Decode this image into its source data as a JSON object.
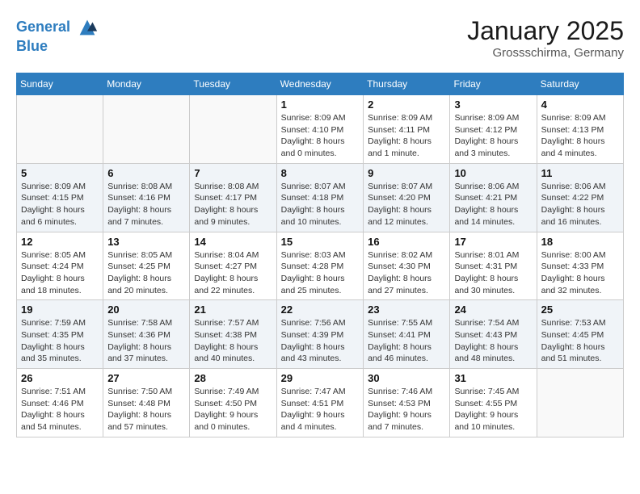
{
  "header": {
    "logo_line1": "General",
    "logo_line2": "Blue",
    "month": "January 2025",
    "location": "Grossschirma, Germany"
  },
  "weekdays": [
    "Sunday",
    "Monday",
    "Tuesday",
    "Wednesday",
    "Thursday",
    "Friday",
    "Saturday"
  ],
  "weeks": [
    [
      {
        "day": "",
        "info": ""
      },
      {
        "day": "",
        "info": ""
      },
      {
        "day": "",
        "info": ""
      },
      {
        "day": "1",
        "info": "Sunrise: 8:09 AM\nSunset: 4:10 PM\nDaylight: 8 hours\nand 0 minutes."
      },
      {
        "day": "2",
        "info": "Sunrise: 8:09 AM\nSunset: 4:11 PM\nDaylight: 8 hours\nand 1 minute."
      },
      {
        "day": "3",
        "info": "Sunrise: 8:09 AM\nSunset: 4:12 PM\nDaylight: 8 hours\nand 3 minutes."
      },
      {
        "day": "4",
        "info": "Sunrise: 8:09 AM\nSunset: 4:13 PM\nDaylight: 8 hours\nand 4 minutes."
      }
    ],
    [
      {
        "day": "5",
        "info": "Sunrise: 8:09 AM\nSunset: 4:15 PM\nDaylight: 8 hours\nand 6 minutes."
      },
      {
        "day": "6",
        "info": "Sunrise: 8:08 AM\nSunset: 4:16 PM\nDaylight: 8 hours\nand 7 minutes."
      },
      {
        "day": "7",
        "info": "Sunrise: 8:08 AM\nSunset: 4:17 PM\nDaylight: 8 hours\nand 9 minutes."
      },
      {
        "day": "8",
        "info": "Sunrise: 8:07 AM\nSunset: 4:18 PM\nDaylight: 8 hours\nand 10 minutes."
      },
      {
        "day": "9",
        "info": "Sunrise: 8:07 AM\nSunset: 4:20 PM\nDaylight: 8 hours\nand 12 minutes."
      },
      {
        "day": "10",
        "info": "Sunrise: 8:06 AM\nSunset: 4:21 PM\nDaylight: 8 hours\nand 14 minutes."
      },
      {
        "day": "11",
        "info": "Sunrise: 8:06 AM\nSunset: 4:22 PM\nDaylight: 8 hours\nand 16 minutes."
      }
    ],
    [
      {
        "day": "12",
        "info": "Sunrise: 8:05 AM\nSunset: 4:24 PM\nDaylight: 8 hours\nand 18 minutes."
      },
      {
        "day": "13",
        "info": "Sunrise: 8:05 AM\nSunset: 4:25 PM\nDaylight: 8 hours\nand 20 minutes."
      },
      {
        "day": "14",
        "info": "Sunrise: 8:04 AM\nSunset: 4:27 PM\nDaylight: 8 hours\nand 22 minutes."
      },
      {
        "day": "15",
        "info": "Sunrise: 8:03 AM\nSunset: 4:28 PM\nDaylight: 8 hours\nand 25 minutes."
      },
      {
        "day": "16",
        "info": "Sunrise: 8:02 AM\nSunset: 4:30 PM\nDaylight: 8 hours\nand 27 minutes."
      },
      {
        "day": "17",
        "info": "Sunrise: 8:01 AM\nSunset: 4:31 PM\nDaylight: 8 hours\nand 30 minutes."
      },
      {
        "day": "18",
        "info": "Sunrise: 8:00 AM\nSunset: 4:33 PM\nDaylight: 8 hours\nand 32 minutes."
      }
    ],
    [
      {
        "day": "19",
        "info": "Sunrise: 7:59 AM\nSunset: 4:35 PM\nDaylight: 8 hours\nand 35 minutes."
      },
      {
        "day": "20",
        "info": "Sunrise: 7:58 AM\nSunset: 4:36 PM\nDaylight: 8 hours\nand 37 minutes."
      },
      {
        "day": "21",
        "info": "Sunrise: 7:57 AM\nSunset: 4:38 PM\nDaylight: 8 hours\nand 40 minutes."
      },
      {
        "day": "22",
        "info": "Sunrise: 7:56 AM\nSunset: 4:39 PM\nDaylight: 8 hours\nand 43 minutes."
      },
      {
        "day": "23",
        "info": "Sunrise: 7:55 AM\nSunset: 4:41 PM\nDaylight: 8 hours\nand 46 minutes."
      },
      {
        "day": "24",
        "info": "Sunrise: 7:54 AM\nSunset: 4:43 PM\nDaylight: 8 hours\nand 48 minutes."
      },
      {
        "day": "25",
        "info": "Sunrise: 7:53 AM\nSunset: 4:45 PM\nDaylight: 8 hours\nand 51 minutes."
      }
    ],
    [
      {
        "day": "26",
        "info": "Sunrise: 7:51 AM\nSunset: 4:46 PM\nDaylight: 8 hours\nand 54 minutes."
      },
      {
        "day": "27",
        "info": "Sunrise: 7:50 AM\nSunset: 4:48 PM\nDaylight: 8 hours\nand 57 minutes."
      },
      {
        "day": "28",
        "info": "Sunrise: 7:49 AM\nSunset: 4:50 PM\nDaylight: 9 hours\nand 0 minutes."
      },
      {
        "day": "29",
        "info": "Sunrise: 7:47 AM\nSunset: 4:51 PM\nDaylight: 9 hours\nand 4 minutes."
      },
      {
        "day": "30",
        "info": "Sunrise: 7:46 AM\nSunset: 4:53 PM\nDaylight: 9 hours\nand 7 minutes."
      },
      {
        "day": "31",
        "info": "Sunrise: 7:45 AM\nSunset: 4:55 PM\nDaylight: 9 hours\nand 10 minutes."
      },
      {
        "day": "",
        "info": ""
      }
    ]
  ]
}
